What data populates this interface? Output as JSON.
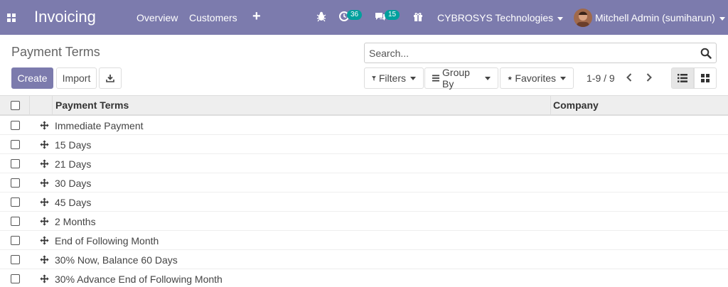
{
  "navbar": {
    "app_title": "Invoicing",
    "menu": [
      "Overview",
      "Customers"
    ],
    "plus": "+",
    "activity_count": "36",
    "messages_count": "15",
    "company": "CYBROSYS Technologies",
    "user": "Mitchell Admin (sumiharun)",
    "colors": {
      "bar": "#7c7bad",
      "badge": "#00a09d"
    }
  },
  "control_panel": {
    "title": "Payment Terms",
    "create_label": "Create",
    "import_label": "Import",
    "search_placeholder": "Search...",
    "filters_label": "Filters",
    "groupby_label": "Group By",
    "favorites_label": "Favorites",
    "pager": "1-9 / 9"
  },
  "table": {
    "columns": [
      "Payment Terms",
      "Company"
    ],
    "rows": [
      "Immediate Payment",
      "15 Days",
      "21 Days",
      "30 Days",
      "45 Days",
      "2 Months",
      "End of Following Month",
      "30% Now, Balance 60 Days",
      "30% Advance End of Following Month"
    ]
  }
}
